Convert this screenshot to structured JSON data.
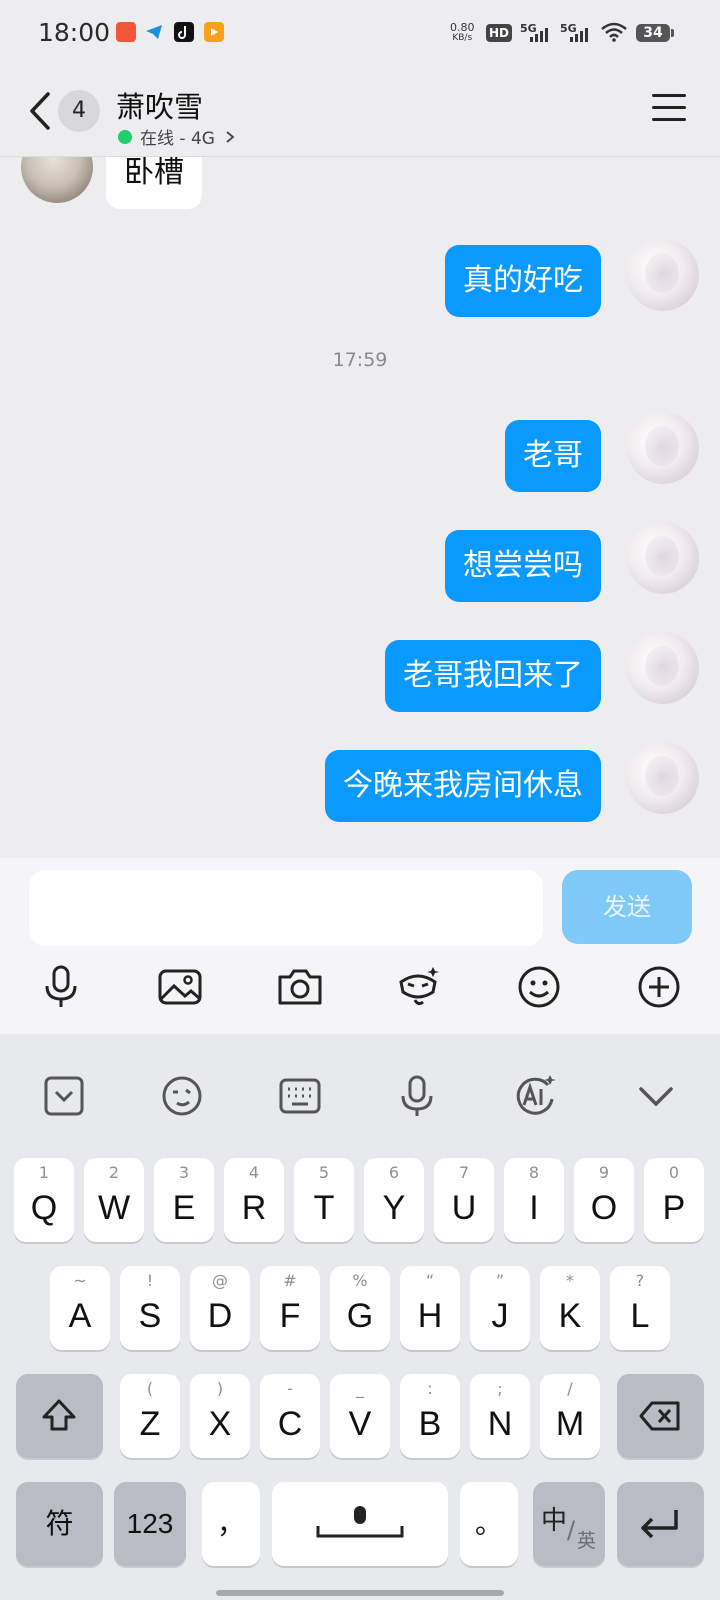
{
  "status_bar": {
    "time": "18:00",
    "speed_value": "0.80",
    "speed_unit": "KB/s",
    "hd_label": "HD",
    "sim1_label": "5G",
    "sim2_label": "5G",
    "battery": "34",
    "app_icons": [
      "app-icon-1",
      "telegram-like-icon",
      "tiktok-icon",
      "video-app-icon"
    ]
  },
  "header": {
    "unread_count": "4",
    "contact_name": "萧吹雪",
    "online_status": "在线 - 4G",
    "status_color": "#1fcf6a"
  },
  "chat": {
    "top_partial_message": "卧槽",
    "messages": [
      {
        "side": "right",
        "text": "真的好吃"
      },
      {
        "timestamp": "17:59"
      },
      {
        "side": "right",
        "text": "老哥"
      },
      {
        "side": "right",
        "text": "想尝尝吗"
      },
      {
        "side": "right",
        "text": "老哥我回来了"
      },
      {
        "side": "right",
        "text": "今晚来我房间休息"
      }
    ],
    "bubble_color": "#0a99ff"
  },
  "composer": {
    "input_value": "",
    "send_label": "发送",
    "tools": [
      "microphone-icon",
      "image-icon",
      "camera-icon",
      "sticker-icon",
      "emoji-icon",
      "plus-icon"
    ]
  },
  "keyboard": {
    "toolbar": [
      "collapse-icon",
      "emoji-icon",
      "keyboard-icon",
      "microphone-icon",
      "ai-icon",
      "chevron-down-icon"
    ],
    "row1": [
      {
        "hint": "1",
        "key": "Q"
      },
      {
        "hint": "2",
        "key": "W"
      },
      {
        "hint": "3",
        "key": "E"
      },
      {
        "hint": "4",
        "key": "R"
      },
      {
        "hint": "5",
        "key": "T"
      },
      {
        "hint": "6",
        "key": "Y"
      },
      {
        "hint": "7",
        "key": "U"
      },
      {
        "hint": "8",
        "key": "I"
      },
      {
        "hint": "9",
        "key": "O"
      },
      {
        "hint": "0",
        "key": "P"
      }
    ],
    "row2": [
      {
        "hint": "~",
        "key": "A"
      },
      {
        "hint": "!",
        "key": "S"
      },
      {
        "hint": "@",
        "key": "D"
      },
      {
        "hint": "#",
        "key": "F"
      },
      {
        "hint": "%",
        "key": "G"
      },
      {
        "hint": "“",
        "key": "H"
      },
      {
        "hint": "”",
        "key": "J"
      },
      {
        "hint": "*",
        "key": "K"
      },
      {
        "hint": "?",
        "key": "L"
      }
    ],
    "row3": [
      {
        "hint": "(",
        "key": "Z"
      },
      {
        "hint": ")",
        "key": "X"
      },
      {
        "hint": "-",
        "key": "C"
      },
      {
        "hint": "_",
        "key": "V"
      },
      {
        "hint": ":",
        "key": "B"
      },
      {
        "hint": ";",
        "key": "N"
      },
      {
        "hint": "/",
        "key": "M"
      }
    ],
    "symbol_key": "符",
    "number_key": "123",
    "comma_key": "，",
    "period_key": "。",
    "lang_key_main": "中",
    "lang_key_alt": "英"
  }
}
